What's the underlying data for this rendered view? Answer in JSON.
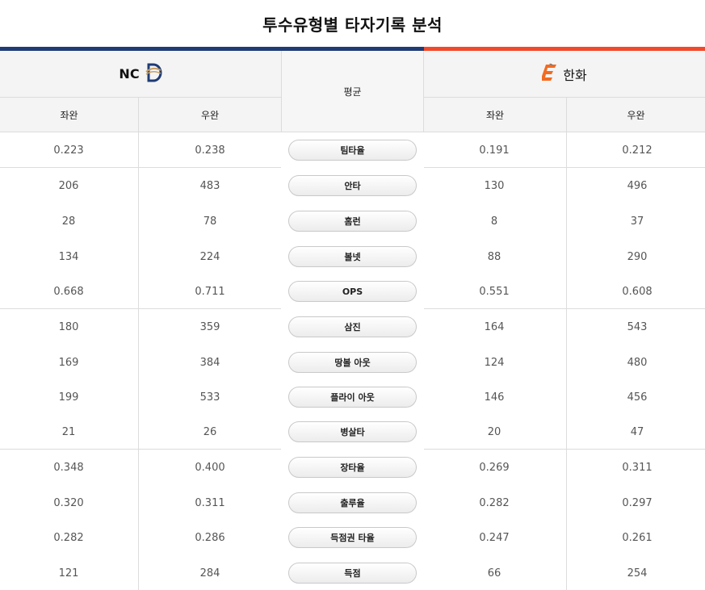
{
  "title": "투수유형별 타자기록 분석",
  "teams": {
    "left": {
      "name": "NC",
      "logo_icon": "nc-dinos-logo-icon"
    },
    "right": {
      "name": "한화",
      "logo_icon": "hanwha-eagles-logo-icon"
    }
  },
  "headers": {
    "center": "평균",
    "left_lhp": "좌완",
    "left_rhp": "우완",
    "right_lhp": "좌완",
    "right_rhp": "우완"
  },
  "colors": {
    "nc_bar": "#1f3c75",
    "hanwha_bar": "#f2492a"
  },
  "rows": [
    {
      "stat": "팀타율",
      "nc_lhp": "0.223",
      "nc_rhp": "0.238",
      "hh_lhp": "0.191",
      "hh_rhp": "0.212"
    },
    {
      "stat": "안타",
      "nc_lhp": "206",
      "nc_rhp": "483",
      "hh_lhp": "130",
      "hh_rhp": "496"
    },
    {
      "stat": "홈런",
      "nc_lhp": "28",
      "nc_rhp": "78",
      "hh_lhp": "8",
      "hh_rhp": "37"
    },
    {
      "stat": "볼넷",
      "nc_lhp": "134",
      "nc_rhp": "224",
      "hh_lhp": "88",
      "hh_rhp": "290"
    },
    {
      "stat": "OPS",
      "nc_lhp": "0.668",
      "nc_rhp": "0.711",
      "hh_lhp": "0.551",
      "hh_rhp": "0.608"
    },
    {
      "stat": "삼진",
      "nc_lhp": "180",
      "nc_rhp": "359",
      "hh_lhp": "164",
      "hh_rhp": "543"
    },
    {
      "stat": "땅볼 아웃",
      "nc_lhp": "169",
      "nc_rhp": "384",
      "hh_lhp": "124",
      "hh_rhp": "480"
    },
    {
      "stat": "플라이 아웃",
      "nc_lhp": "199",
      "nc_rhp": "533",
      "hh_lhp": "146",
      "hh_rhp": "456"
    },
    {
      "stat": "병살타",
      "nc_lhp": "21",
      "nc_rhp": "26",
      "hh_lhp": "20",
      "hh_rhp": "47"
    },
    {
      "stat": "장타율",
      "nc_lhp": "0.348",
      "nc_rhp": "0.400",
      "hh_lhp": "0.269",
      "hh_rhp": "0.311"
    },
    {
      "stat": "출루율",
      "nc_lhp": "0.320",
      "nc_rhp": "0.311",
      "hh_lhp": "0.282",
      "hh_rhp": "0.297"
    },
    {
      "stat": "득점권 타율",
      "nc_lhp": "0.282",
      "nc_rhp": "0.286",
      "hh_lhp": "0.247",
      "hh_rhp": "0.261"
    },
    {
      "stat": "득점",
      "nc_lhp": "121",
      "nc_rhp": "284",
      "hh_lhp": "66",
      "hh_rhp": "254"
    }
  ]
}
